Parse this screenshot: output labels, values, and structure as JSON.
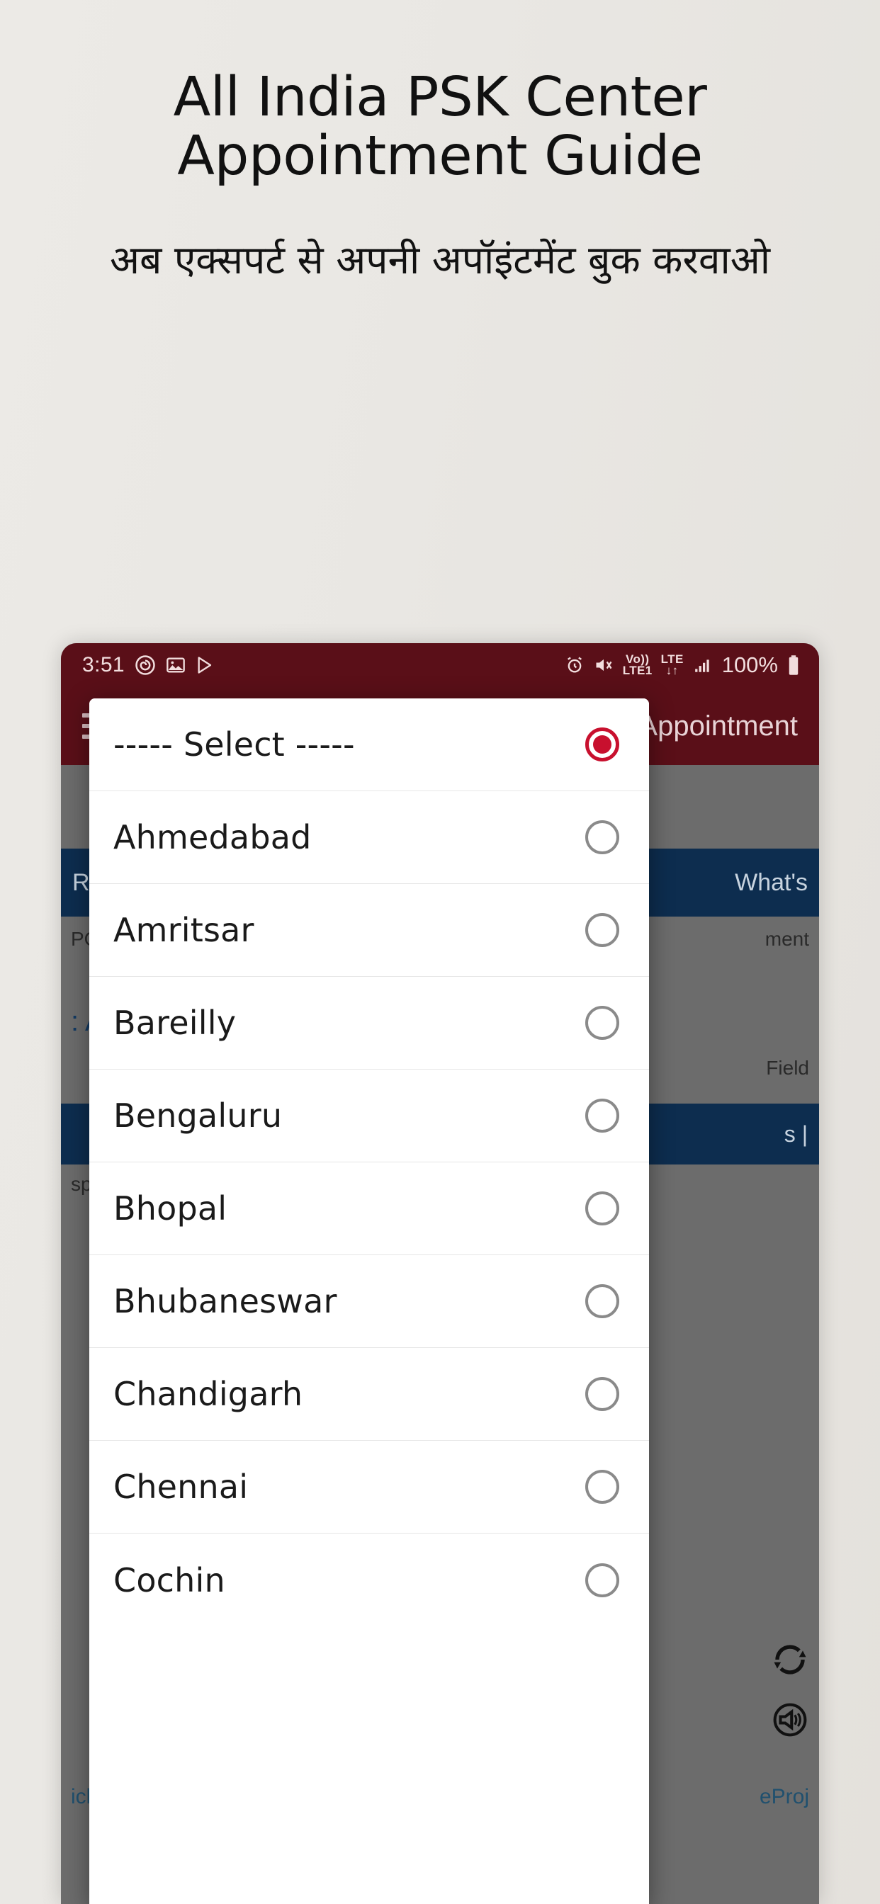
{
  "promo": {
    "title": "All India PSK Center Appointment Guide",
    "subtitle": "अब एक्सपर्ट से अपनी अपॉइंटमेंट बुक करवाओ"
  },
  "status_bar": {
    "time": "3:51",
    "left_icons": [
      "spiral-app-icon",
      "gallery-icon",
      "play-store-icon"
    ],
    "alarm": "alarm-icon",
    "mute": "vibrate-mute-icon",
    "volte_top": "Vo))",
    "volte_bottom": "LTE1",
    "network": "LTE",
    "signal": "signal-bars-icon",
    "battery_percent": "100%",
    "battery_icon": "battery-full-icon"
  },
  "app_bar": {
    "menu_icon": "hamburger-menu-icon",
    "title": "Passport Seva Appointment"
  },
  "background": {
    "card_left": "RTI",
    "card_right": "What's",
    "row_pops_left": "POPS",
    "row_pops_right": "ment",
    "row_avail_left": ": Av",
    "row_field_right": "Field",
    "row_display_left": "splay",
    "row_bottom_left": "ick h",
    "row_bottom_right": "eProj",
    "card2_left": "s |",
    "refresh_icon": "refresh-icon",
    "speaker_icon": "speaker-icon"
  },
  "dialog": {
    "name": "city-select-dialog",
    "options": [
      {
        "label": "----- Select -----",
        "selected": true
      },
      {
        "label": "Ahmedabad",
        "selected": false
      },
      {
        "label": "Amritsar",
        "selected": false
      },
      {
        "label": "Bareilly",
        "selected": false
      },
      {
        "label": "Bengaluru",
        "selected": false
      },
      {
        "label": "Bhopal",
        "selected": false
      },
      {
        "label": "Bhubaneswar",
        "selected": false
      },
      {
        "label": "Chandigarh",
        "selected": false
      },
      {
        "label": "Chennai",
        "selected": false
      },
      {
        "label": "Cochin",
        "selected": false
      }
    ]
  },
  "colors": {
    "page_bg": "#eceae6",
    "app_bar": "#5a0f18",
    "accent_red": "#c8102e",
    "navy": "#0d2d4f",
    "scrim": "#6c6c6c"
  }
}
